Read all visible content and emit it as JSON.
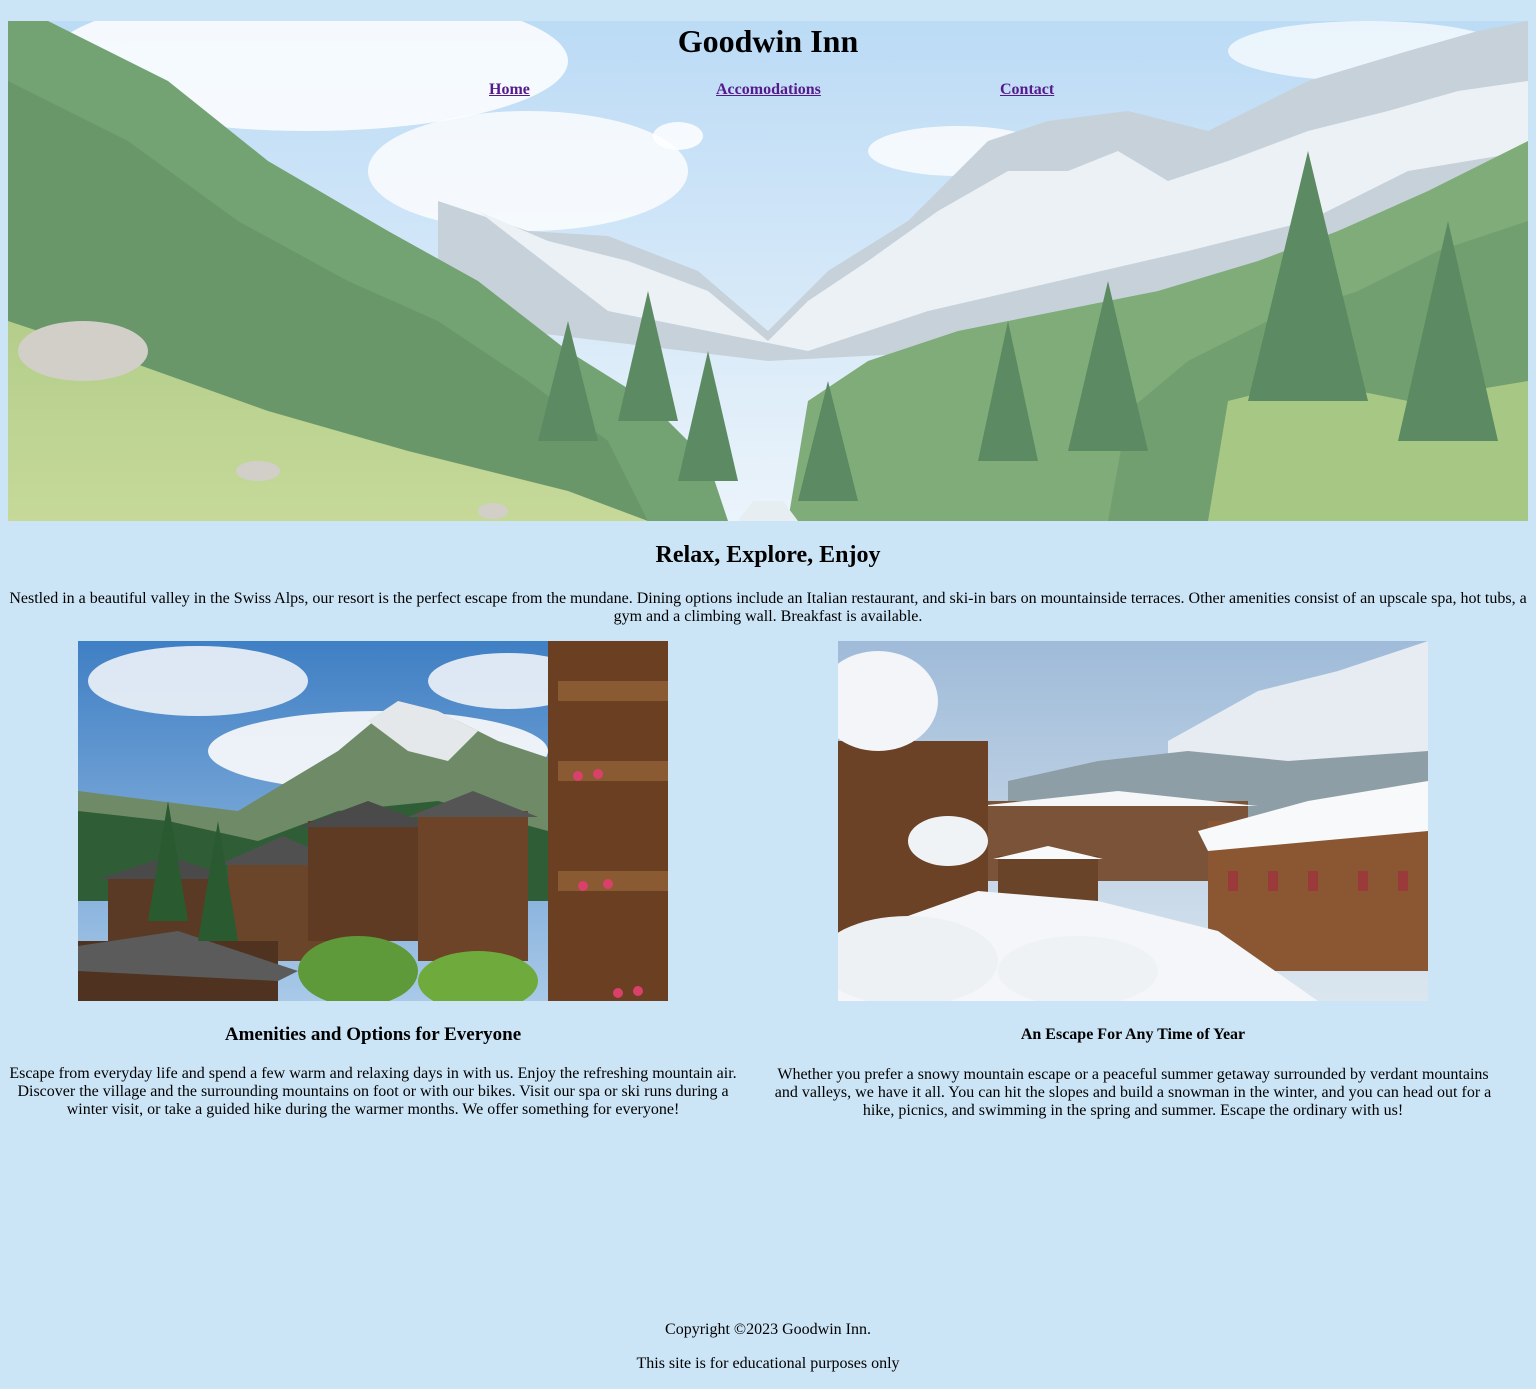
{
  "header": {
    "title": "Goodwin Inn",
    "nav": [
      {
        "label": "Home"
      },
      {
        "label": "Accomodations"
      },
      {
        "label": "Contact"
      }
    ]
  },
  "intro": {
    "heading": "Relax, Explore, Enjoy",
    "text": "Nestled in a beautiful valley in the Swiss Alps, our resort is the perfect escape from the mundane. Dining options include an Italian restaurant, and ski-in bars on mountainside terraces. Other amenities consist of an upscale spa, hot tubs, a gym and a climbing wall. Breakfast is available."
  },
  "columns": [
    {
      "heading": "Amenities and Options for Everyone",
      "text": "Escape from everyday life and spend a few warm and relaxing days in with us. Enjoy the refreshing mountain air. Discover the village and the surrounding mountains on foot or with our bikes. Visit our spa or ski runs during a winter visit, or take a guided hike during the warmer months. We offer something for everyone!"
    },
    {
      "heading": "An Escape For Any Time of Year",
      "text": "Whether you prefer a snowy mountain escape or a peaceful summer getaway surrounded by verdant mountains and valleys, we have it all. You can hit the slopes and build a snowman in the winter, and you can head out for a hike, picnics, and swimming in the spring and summer. Escape the ordinary with us!"
    }
  ],
  "footer": {
    "copyright": "Copyright ©2023 Goodwin Inn.",
    "note": "This site is for educational purposes only"
  },
  "colors": {
    "page_background": "#cce5f6",
    "link": "#551a8b"
  }
}
